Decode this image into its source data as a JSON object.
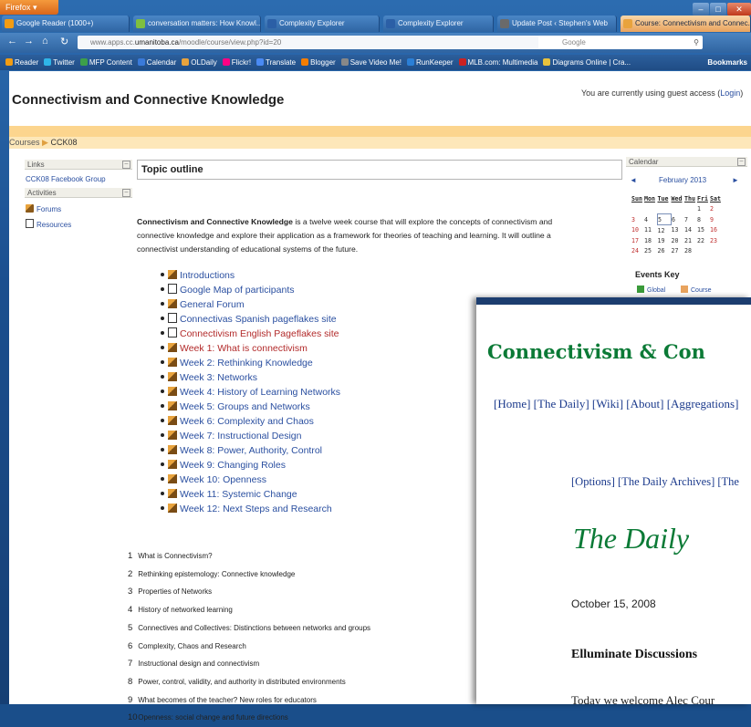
{
  "browser": {
    "app_button": "Firefox",
    "tabs": [
      {
        "label": "Google Reader (1000+)",
        "color": "#f39c12"
      },
      {
        "label": "conversation matters: How Knowl...",
        "color": "#7fbf3f"
      },
      {
        "label": "Complexity Explorer",
        "color": "#2b5fa6"
      },
      {
        "label": "Complexity Explorer",
        "color": "#2b5fa6"
      },
      {
        "label": "Update Post ‹ Stephen's Web",
        "color": "#6a6a6a"
      },
      {
        "label": "Course: Connectivism and Connec...",
        "color": "#e8a33d"
      }
    ],
    "url_prefix": "www.apps.cc.",
    "url_domain": "umanitoba.ca",
    "url_path": "/moodle/course/view.php?id=20",
    "search_placeholder": "Google",
    "bookmarks": [
      {
        "label": "Reader",
        "color": "#f39c12"
      },
      {
        "label": "Twitter",
        "color": "#2fb5e8"
      },
      {
        "label": "MFP Content",
        "color": "#3da04a"
      },
      {
        "label": "Calendar",
        "color": "#3a7ad9"
      },
      {
        "label": "OLDaily",
        "color": "#e8a33d"
      },
      {
        "label": "Flickr!",
        "color": "#ff0084"
      },
      {
        "label": "Translate",
        "color": "#4a8af4"
      },
      {
        "label": "Blogger",
        "color": "#f57d00"
      },
      {
        "label": "Save Video Me!",
        "color": "#888888"
      },
      {
        "label": "RunKeeper",
        "color": "#2b7fd6"
      },
      {
        "label": "MLB.com: Multimedia",
        "color": "#cc2222"
      },
      {
        "label": "Diagrams Online | Cra...",
        "color": "#e8c23d"
      }
    ],
    "bookmarks_right": "Bookmarks"
  },
  "moodle": {
    "site_title": "Connectivism and Connective Knowledge",
    "guest_text": "You are currently using guest access (",
    "login": "Login",
    "guest_close": ")",
    "breadcrumb_root": "Courses",
    "breadcrumb_sep": "▶",
    "breadcrumb_course": "CCK08",
    "links_block": {
      "title": "Links",
      "items": [
        "CCK08 Facebook Group"
      ]
    },
    "activities_block": {
      "title": "Activities",
      "items": [
        "Forums",
        "Resources"
      ]
    },
    "outline_title": "Topic outline",
    "description_bold": "Connectivism and Connective Knowledge",
    "description_rest": " is a twelve week course that will explore the concepts of connectivism and connective knowledge and explore their application as a framework for theories of teaching and learning. It will outline a connectivist understanding of educational systems of the future.",
    "items": [
      {
        "label": "Introductions",
        "icon": "forum-icon",
        "red": false
      },
      {
        "label": "Google Map of participants",
        "icon": "page-icon",
        "red": false
      },
      {
        "label": "General Forum",
        "icon": "forum-icon",
        "red": false
      },
      {
        "label": "Connectivas Spanish pageflakes site",
        "icon": "page-icon",
        "red": false
      },
      {
        "label": "Connectivism English Pageflakes site",
        "icon": "page-icon",
        "red": true
      },
      {
        "label": "Week 1: What is connectivism",
        "icon": "forum-icon",
        "red": true
      },
      {
        "label": "Week 2: Rethinking Knowledge",
        "icon": "forum-icon",
        "red": false
      },
      {
        "label": "Week 3: Networks",
        "icon": "forum-icon",
        "red": false
      },
      {
        "label": "Week 4: History of Learning Networks",
        "icon": "forum-icon",
        "red": false
      },
      {
        "label": "Week 5: Groups and Networks",
        "icon": "forum-icon",
        "red": false
      },
      {
        "label": "Week 6: Complexity and Chaos",
        "icon": "forum-icon",
        "red": false
      },
      {
        "label": "Week 7: Instructional Design",
        "icon": "forum-icon",
        "red": false
      },
      {
        "label": "Week 8: Power, Authority, Control",
        "icon": "forum-icon",
        "red": false
      },
      {
        "label": "Week 9: Changing Roles",
        "icon": "forum-icon",
        "red": false
      },
      {
        "label": "Week 10: Openness",
        "icon": "forum-icon",
        "red": false
      },
      {
        "label": "Week 11: Systemic Change",
        "icon": "forum-icon",
        "red": false
      },
      {
        "label": "Week 12: Next Steps and Research",
        "icon": "forum-icon",
        "red": false
      }
    ],
    "topics": [
      {
        "n": "1",
        "label": "What is Connectivism?"
      },
      {
        "n": "2",
        "label": "Rethinking epistemology: Connective knowledge"
      },
      {
        "n": "3",
        "label": "Properties of Networks"
      },
      {
        "n": "4",
        "label": "History of networked learning"
      },
      {
        "n": "5",
        "label": "Connectives and Collectives: Distinctions between networks and groups"
      },
      {
        "n": "6",
        "label": "Complexity, Chaos and Research"
      },
      {
        "n": "7",
        "label": "Instructional design and connectivism"
      },
      {
        "n": "8",
        "label": "Power, control, validity, and authority in distributed environments"
      },
      {
        "n": "9",
        "label": "What becomes of the teacher? New roles for educators"
      },
      {
        "n": "10",
        "label": "Openness: social change and future directions"
      }
    ],
    "calendar": {
      "title": "Calendar",
      "prev": "◄",
      "next": "►",
      "month": "February 2013",
      "days": [
        "Sun",
        "Mon",
        "Tue",
        "Wed",
        "Thu",
        "Fri",
        "Sat"
      ],
      "weeks": [
        [
          "",
          "",
          "",
          "",
          "",
          "1",
          "2"
        ],
        [
          "3",
          "4",
          "5",
          "6",
          "7",
          "8",
          "9"
        ],
        [
          "10",
          "11",
          "12",
          "13",
          "14",
          "15",
          "16"
        ],
        [
          "17",
          "18",
          "19",
          "20",
          "21",
          "22",
          "23"
        ],
        [
          "24",
          "25",
          "26",
          "27",
          "28",
          "",
          ""
        ]
      ],
      "today": "5",
      "events_key": "Events Key",
      "key_global": "Global",
      "key_course": "Course"
    }
  },
  "overlay": {
    "title": "Connectivism & Con",
    "nav": "[Home] [The Daily] [Wiki] [About] [Aggregations]",
    "nav2": "[Options] [The Daily Archives] [The",
    "daily": "The Daily",
    "date": "October 15, 2008",
    "headline": "Elluminate Discussions",
    "text": "Today we welcome Alec Cour"
  }
}
